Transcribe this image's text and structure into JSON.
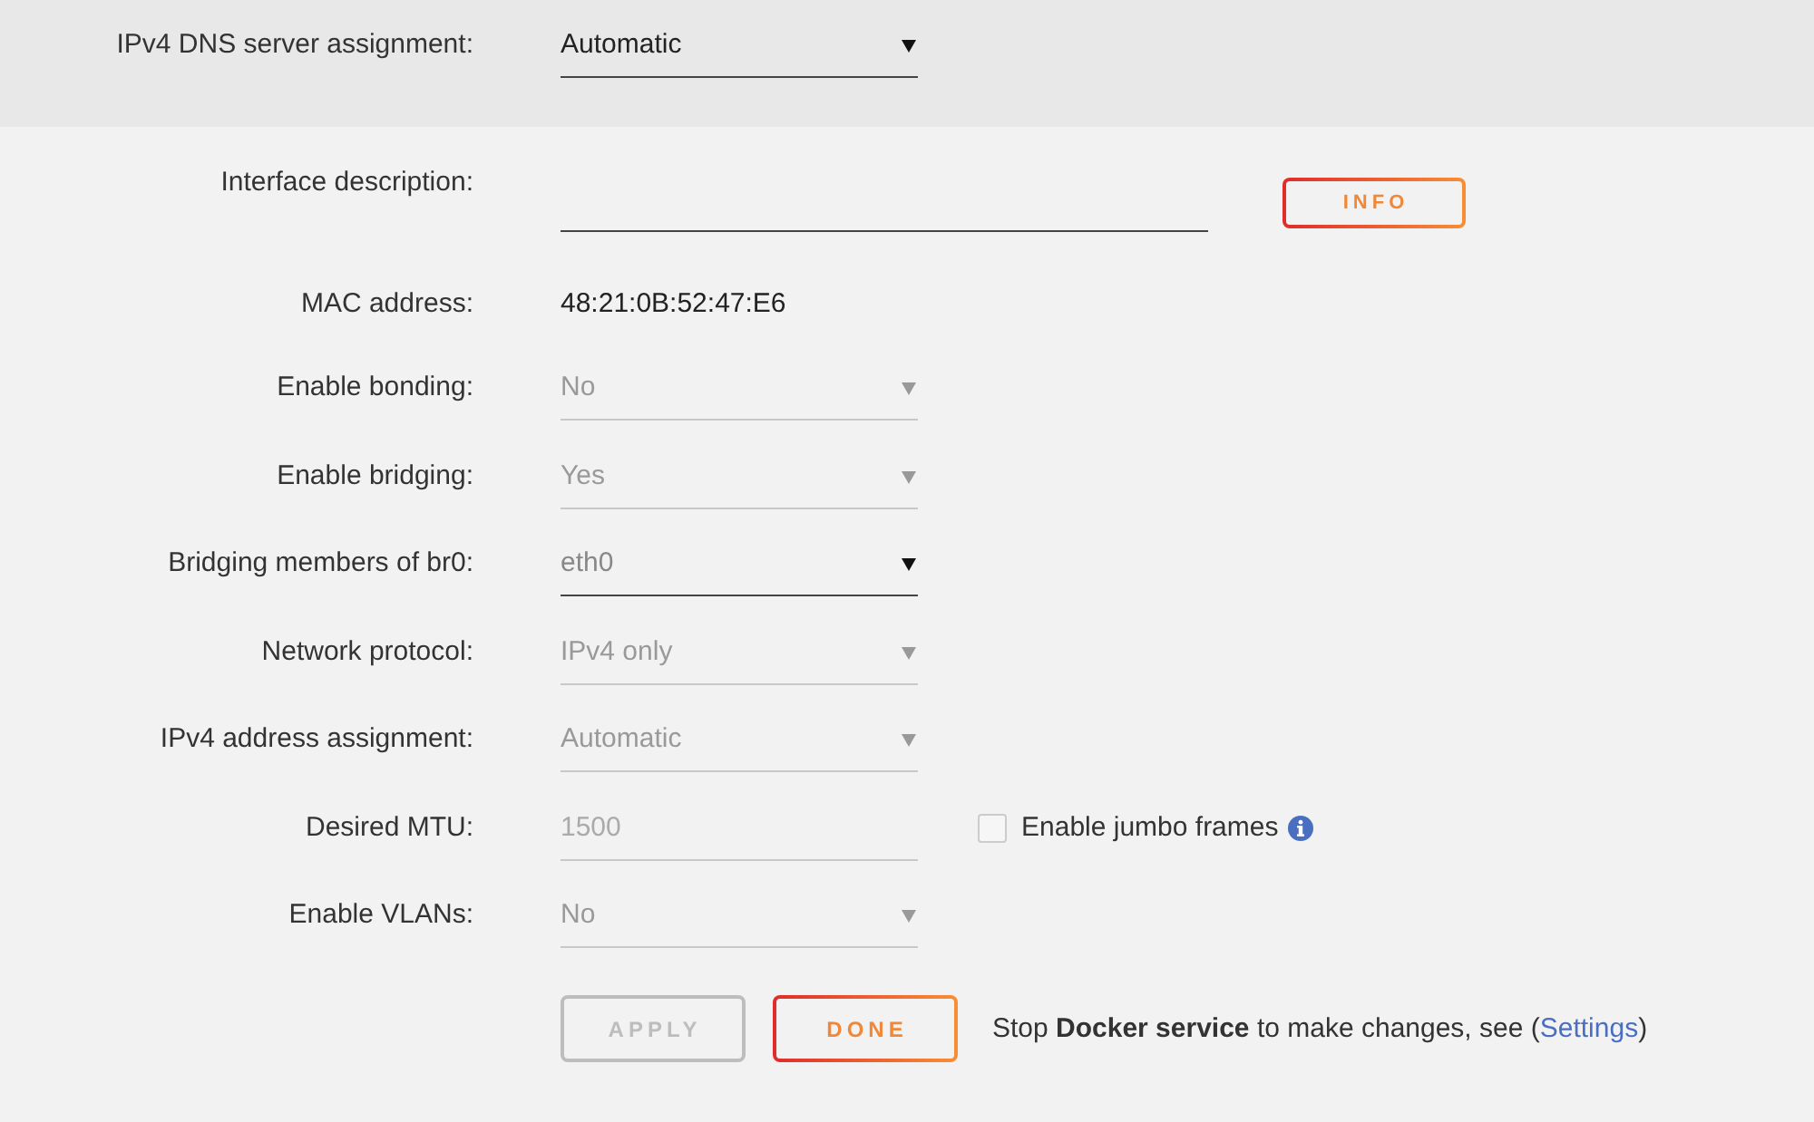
{
  "dns_section": {
    "label": "IPv4 DNS server assignment:",
    "kind": "select",
    "value": "Automatic",
    "disabled": false
  },
  "fields": [
    {
      "label": "Interface description:",
      "kind": "text",
      "button": "INFO"
    },
    {
      "label": "MAC address:",
      "kind": "static",
      "value": "48:21:0B:52:47:E6"
    },
    {
      "label": "Enable bonding:",
      "kind": "select",
      "value": "No",
      "disabled": true
    },
    {
      "label": "Enable bridging:",
      "kind": "select",
      "value": "Yes",
      "disabled": true
    },
    {
      "label": "Bridging members of br0:",
      "kind": "multiselect",
      "value": "eth0",
      "disabled": false
    },
    {
      "label": "Network protocol:",
      "kind": "select",
      "value": "IPv4 only",
      "disabled": true
    },
    {
      "label": "IPv4 address assignment:",
      "kind": "select",
      "value": "Automatic",
      "disabled": true
    },
    {
      "label": "Desired MTU:",
      "kind": "number",
      "value": "1500",
      "disabled": true,
      "checkbox": {
        "label": "Enable jumbo frames",
        "checked": false
      }
    },
    {
      "label": "Enable VLANs:",
      "kind": "select",
      "value": "No",
      "disabled": true
    }
  ],
  "buttons": [
    {
      "label": "APPLY",
      "disabled": true
    },
    {
      "label": "DONE",
      "disabled": false
    }
  ],
  "note": {
    "text": "Stop **Docker service** to make changes, see (",
    "link": "Settings",
    "suffix": ")"
  }
}
